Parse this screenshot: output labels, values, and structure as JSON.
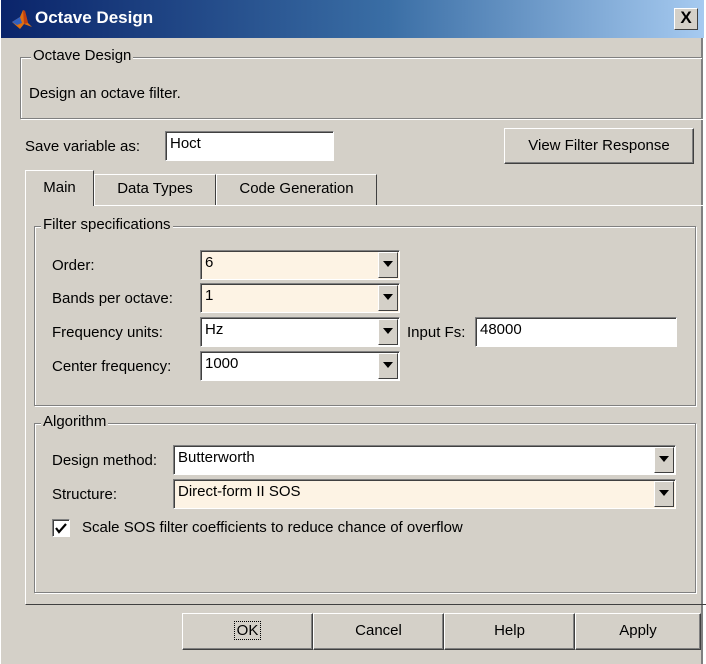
{
  "window": {
    "title": "Octave Design",
    "close_label": "X"
  },
  "header_group": {
    "legend": "Octave Design",
    "description": "Design an octave filter."
  },
  "save": {
    "label": "Save variable as:",
    "value": "Hoct"
  },
  "view_response_button": "View Filter Response",
  "tabs": [
    {
      "label": "Main",
      "active": true
    },
    {
      "label": "Data Types",
      "active": false
    },
    {
      "label": "Code Generation",
      "active": false
    }
  ],
  "filter_specs": {
    "legend": "Filter specifications",
    "order": {
      "label": "Order:",
      "value": "6"
    },
    "bands": {
      "label": "Bands per octave:",
      "value": "1"
    },
    "frequency_units": {
      "label": "Frequency units:",
      "value": "Hz"
    },
    "input_fs": {
      "label": "Input Fs:",
      "value": "48000"
    },
    "center_frequency": {
      "label": "Center frequency:",
      "value": "1000"
    }
  },
  "algorithm": {
    "legend": "Algorithm",
    "design_method": {
      "label": "Design method:",
      "value": "Butterworth"
    },
    "structure": {
      "label": "Structure:",
      "value": "Direct-form II SOS"
    },
    "scale_checkbox": {
      "label": "Scale SOS filter coefficients to reduce chance of overflow",
      "checked": true
    }
  },
  "buttons": {
    "ok": "OK",
    "cancel": "Cancel",
    "help": "Help",
    "apply": "Apply"
  },
  "colors": {
    "title_bar_start": "#0a246a",
    "title_bar_end": "#a6caf0",
    "face": "#d4d0c8",
    "highlight_field": "#fdf3e4"
  }
}
